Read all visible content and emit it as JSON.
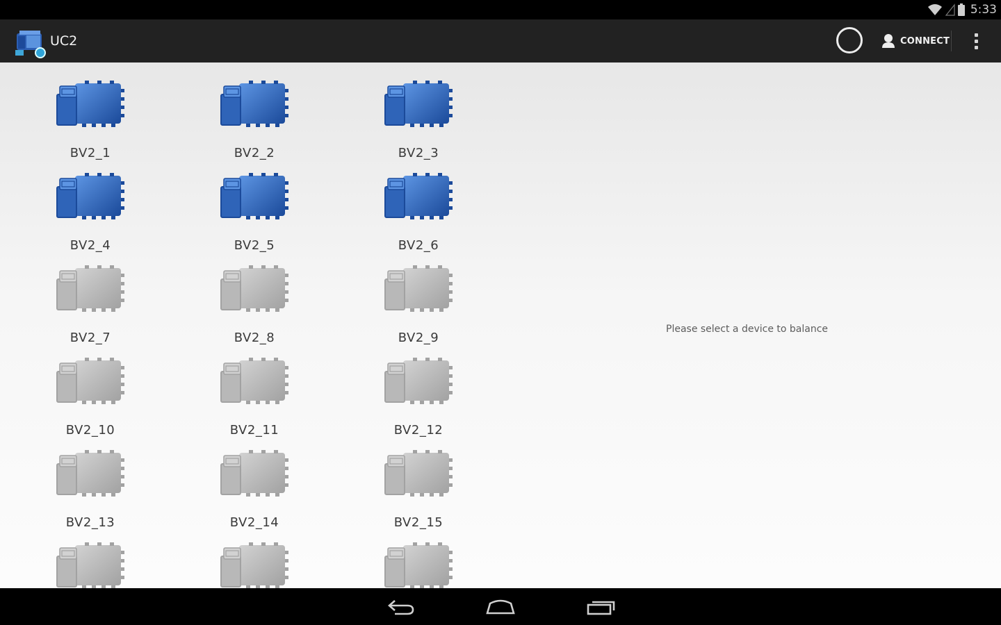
{
  "status_bar": {
    "time": "5:33",
    "icons": [
      "wifi-icon",
      "signal-icon",
      "battery-icon"
    ]
  },
  "action_bar": {
    "app_icon": "uc2-app-icon",
    "title": "UC2",
    "connect_label": "CONNECT",
    "overflow_icon": "overflow-menu-icon"
  },
  "devices": [
    {
      "label": "BV2_1",
      "state": "active"
    },
    {
      "label": "BV2_2",
      "state": "active"
    },
    {
      "label": "BV2_3",
      "state": "active"
    },
    {
      "label": "BV2_4",
      "state": "active"
    },
    {
      "label": "BV2_5",
      "state": "active"
    },
    {
      "label": "BV2_6",
      "state": "active"
    },
    {
      "label": "BV2_7",
      "state": "inactive"
    },
    {
      "label": "BV2_8",
      "state": "inactive"
    },
    {
      "label": "BV2_9",
      "state": "inactive"
    },
    {
      "label": "BV2_10",
      "state": "inactive"
    },
    {
      "label": "BV2_11",
      "state": "inactive"
    },
    {
      "label": "BV2_12",
      "state": "inactive"
    },
    {
      "label": "BV2_13",
      "state": "inactive"
    },
    {
      "label": "BV2_14",
      "state": "inactive"
    },
    {
      "label": "BV2_15",
      "state": "inactive"
    },
    {
      "label": "",
      "state": "inactive"
    },
    {
      "label": "",
      "state": "inactive"
    },
    {
      "label": "",
      "state": "inactive"
    }
  ],
  "detail_panel": {
    "message": "Please select a device to balance"
  },
  "colors": {
    "active_device": "#2f64b8",
    "inactive_device": "#b8b8b8",
    "action_bar": "#222222"
  },
  "nav_bar": {
    "icons": [
      "back-icon",
      "home-icon",
      "recent-apps-icon"
    ]
  }
}
